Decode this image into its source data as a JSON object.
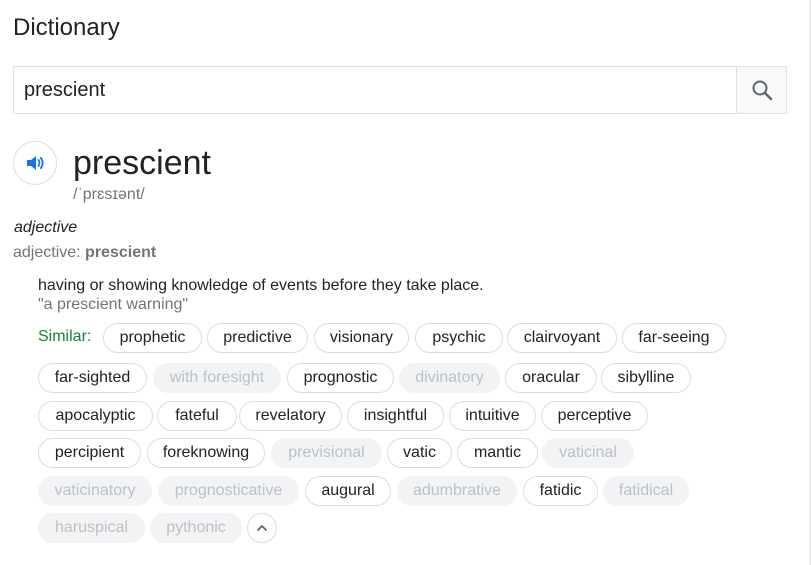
{
  "title": "Dictionary",
  "search": {
    "value": "prescient"
  },
  "entry": {
    "word": "prescient",
    "phonetic": "/ˈprɛsɪənt/",
    "part_of_speech": "adjective",
    "form_label": "adjective:",
    "form_word": "prescient",
    "definition": "having or showing knowledge of events before they take place.",
    "example": "\"a prescient warning\""
  },
  "similar": {
    "label": "Similar:",
    "chips": [
      {
        "label": "prophetic",
        "enabled": true
      },
      {
        "label": "predictive",
        "enabled": true
      },
      {
        "label": "visionary",
        "enabled": true
      },
      {
        "label": "psychic",
        "enabled": true
      },
      {
        "label": "clairvoyant",
        "enabled": true
      },
      {
        "label": "far-seeing",
        "enabled": true
      },
      {
        "label": "far-sighted",
        "enabled": true
      },
      {
        "label": "with foresight",
        "enabled": false
      },
      {
        "label": "prognostic",
        "enabled": true
      },
      {
        "label": "divinatory",
        "enabled": false
      },
      {
        "label": "oracular",
        "enabled": true
      },
      {
        "label": "sibylline",
        "enabled": true
      },
      {
        "label": "apocalyptic",
        "enabled": true
      },
      {
        "label": "fateful",
        "enabled": true
      },
      {
        "label": "revelatory",
        "enabled": true
      },
      {
        "label": "insightful",
        "enabled": true
      },
      {
        "label": "intuitive",
        "enabled": true
      },
      {
        "label": "perceptive",
        "enabled": true
      },
      {
        "label": "percipient",
        "enabled": true
      },
      {
        "label": "foreknowing",
        "enabled": true
      },
      {
        "label": "previsional",
        "enabled": false
      },
      {
        "label": "vatic",
        "enabled": true
      },
      {
        "label": "mantic",
        "enabled": true
      },
      {
        "label": "vaticinal",
        "enabled": false
      },
      {
        "label": "vaticinatory",
        "enabled": false
      },
      {
        "label": "prognosticative",
        "enabled": false
      },
      {
        "label": "augural",
        "enabled": true
      },
      {
        "label": "adumbrative",
        "enabled": false
      },
      {
        "label": "fatidic",
        "enabled": true
      },
      {
        "label": "fatidical",
        "enabled": false
      },
      {
        "label": "haruspical",
        "enabled": false
      },
      {
        "label": "pythonic",
        "enabled": false
      }
    ]
  },
  "icons": {
    "search": "search-icon",
    "speaker": "speaker-icon",
    "collapse": "chevron-up-icon"
  },
  "colors": {
    "accent_blue": "#1a73e8",
    "similar_green": "#188038",
    "muted_text": "#70757a"
  }
}
